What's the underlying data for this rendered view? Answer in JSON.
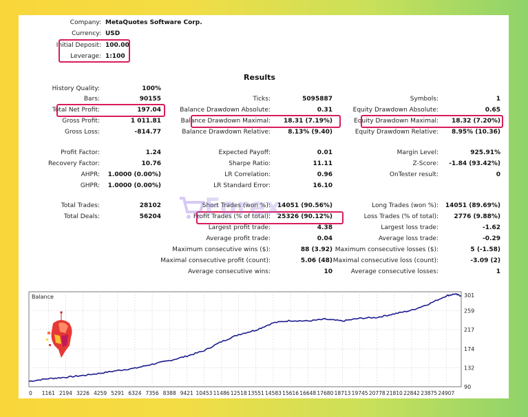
{
  "header": {
    "company_label": "Company:",
    "company_value": "MetaQuotes Software Corp.",
    "currency_label": "Currency:",
    "currency_value": "USD",
    "deposit_label": "Initial Deposit:",
    "deposit_value": "100.00",
    "leverage_label": "Leverage:",
    "leverage_value": "1:100"
  },
  "results_title": "Results",
  "col1": [
    {
      "label": "History Quality:",
      "value": "100%"
    },
    {
      "label": "Bars:",
      "value": "90155"
    },
    {
      "label": "Total Net Profit:",
      "value": "197.04"
    },
    {
      "label": "Gross Profit:",
      "value": "1 011.81"
    },
    {
      "label": "Gross Loss:",
      "value": "-814.77"
    },
    {
      "label": "Profit Factor:",
      "value": "1.24"
    },
    {
      "label": "Recovery Factor:",
      "value": "10.76"
    },
    {
      "label": "AHPR:",
      "value": "1.0000 (0.00%)"
    },
    {
      "label": "GHPR:",
      "value": "1.0000 (0.00%)"
    },
    {
      "label": "Total Trades:",
      "value": "28102"
    },
    {
      "label": "Total Deals:",
      "value": "56204"
    }
  ],
  "col2": [
    {
      "label": "Ticks:",
      "value": "5095887"
    },
    {
      "label": "Balance Drawdown Absolute:",
      "value": "0.31"
    },
    {
      "label": "Balance Drawdown Maximal:",
      "value": "18.31 (7.19%)"
    },
    {
      "label": "Balance Drawdown Relative:",
      "value": "8.13% (9.40)"
    },
    {
      "label": "Expected Payoff:",
      "value": "0.01"
    },
    {
      "label": "Sharpe Ratio:",
      "value": "11.11"
    },
    {
      "label": "LR Correlation:",
      "value": "0.96"
    },
    {
      "label": "LR Standard Error:",
      "value": "16.10"
    },
    {
      "label": "Short Trades (won %):",
      "value": "14051 (90.56%)"
    },
    {
      "label": "Profit Trades (% of total):",
      "value": "25326 (90.12%)"
    },
    {
      "label": "Largest profit trade:",
      "value": "4.38"
    },
    {
      "label": "Average profit trade:",
      "value": "0.04"
    },
    {
      "label": "Maximum consecutive wins ($):",
      "value": "88 (3.92)"
    },
    {
      "label": "Maximal consecutive profit (count):",
      "value": "5.06 (48)"
    },
    {
      "label": "Average consecutive wins:",
      "value": "10"
    }
  ],
  "col3": [
    {
      "label": "Symbols:",
      "value": "1"
    },
    {
      "label": "Equity Drawdown Absolute:",
      "value": "0.65"
    },
    {
      "label": "Equity Drawdown Maximal:",
      "value": "18.32 (7.20%)"
    },
    {
      "label": "Equity Drawdown Relative:",
      "value": "8.95% (10.36)"
    },
    {
      "label": "Margin Level:",
      "value": "925.91%"
    },
    {
      "label": "Z-Score:",
      "value": "-1.84 (93.42%)"
    },
    {
      "label": "OnTester result:",
      "value": "0"
    },
    {
      "label": "Long Trades (won %):",
      "value": "14051 (89.69%)"
    },
    {
      "label": "Loss Trades (% of total):",
      "value": "2776 (9.88%)"
    },
    {
      "label": "Largest loss trade:",
      "value": "-1.62"
    },
    {
      "label": "Average loss trade:",
      "value": "-0.29"
    },
    {
      "label": "Maximum consecutive losses ($):",
      "value": "5 (-1.58)"
    },
    {
      "label": "Maximal consecutive loss (count):",
      "value": "-3.09 (2)"
    },
    {
      "label": "Average consecutive losses:",
      "value": "1"
    }
  ],
  "watermark_text": "Forex",
  "colors": {
    "highlight": "#d81b5a",
    "balance_line": "#1a1a8c",
    "chart_grid": "#d4d4d4"
  },
  "chart_data": {
    "type": "line",
    "title": "Balance",
    "x_ticks": [
      "0",
      "1161",
      "2194",
      "3226",
      "4259",
      "5291",
      "6324",
      "7356",
      "8388",
      "9421",
      "10453",
      "11486",
      "12518",
      "13551",
      "14583",
      "15616",
      "16648",
      "17680",
      "18713",
      "19745",
      "20778",
      "21810",
      "22842",
      "23875",
      "24907"
    ],
    "y_ticks": [
      "301",
      "259",
      "217",
      "174",
      "132",
      "90"
    ],
    "ylim": [
      90,
      301
    ],
    "xlim": [
      0,
      25800
    ],
    "series": [
      {
        "x": [
          0,
          1161,
          2194,
          3226,
          4259,
          5291,
          6324,
          7356,
          8388,
          9421,
          10453,
          11486,
          12518,
          13551,
          14583,
          15616,
          16648,
          17680,
          18713,
          19745,
          20778,
          21810,
          22842,
          23875,
          24907,
          25400,
          25800
        ],
        "y": [
          102,
          108,
          111,
          115,
          120,
          126,
          131,
          140,
          148,
          158,
          170,
          190,
          206,
          216,
          232,
          237,
          236,
          240,
          236,
          242,
          244,
          252,
          260,
          274,
          292,
          296,
          292
        ]
      }
    ]
  }
}
